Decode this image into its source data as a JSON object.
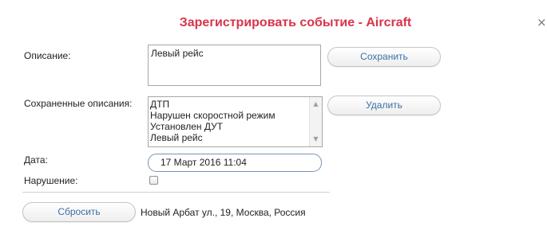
{
  "dialog": {
    "title": "Зарегистрировать событие - Aircraft",
    "close_glyph": "×"
  },
  "description": {
    "label": "Описание:",
    "value": "Левый рейс"
  },
  "buttons": {
    "save": "Сохранить",
    "delete": "Удалить",
    "reset": "Сбросить"
  },
  "saved_descriptions": {
    "label": "Сохраненные описания:",
    "items": [
      "ДТП",
      "Нарушен скоростной режим",
      "Установлен ДУТ",
      "Левый рейс"
    ]
  },
  "date": {
    "label": "Дата:",
    "value": "17 Март 2016 11:04"
  },
  "violation": {
    "label": "Нарушение:",
    "checked": false
  },
  "address": "Новый Арбат ул., 19, Москва, Россия",
  "colors": {
    "title": "#d9344a",
    "button_text": "#3a6fa8",
    "date_border": "#7a93b5"
  },
  "icons": {
    "close": "close-icon",
    "scroll_up": "scroll-up-icon",
    "scroll_down": "scroll-down-icon"
  }
}
